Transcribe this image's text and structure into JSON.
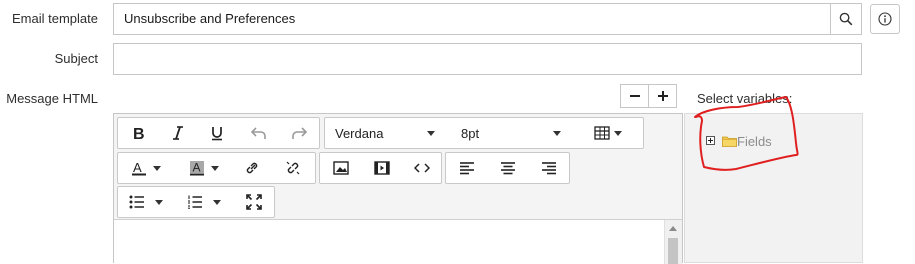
{
  "form": {
    "email_template_label": "Email template",
    "email_template_value": "Unsubscribe and Preferences",
    "subject_label": "Subject",
    "subject_value": "",
    "message_html_label": "Message HTML"
  },
  "editor": {
    "font_family": "Verdana",
    "font_size": "8pt"
  },
  "variables": {
    "title": "Select variables:",
    "tree_root_label": "Fields",
    "annotation_color": "#e02020"
  },
  "icons": [
    "search-icon",
    "info-icon",
    "minus-icon",
    "plus-icon",
    "bold-icon",
    "italic-icon",
    "underline-icon",
    "undo-icon",
    "redo-icon",
    "table-icon",
    "font-color-icon",
    "background-color-icon",
    "link-icon",
    "unlink-icon",
    "image-icon",
    "video-icon",
    "source-code-icon",
    "align-left-icon",
    "align-center-icon",
    "align-right-icon",
    "bullet-list-icon",
    "numbered-list-icon",
    "fullscreen-icon",
    "expand-icon",
    "folder-icon"
  ]
}
